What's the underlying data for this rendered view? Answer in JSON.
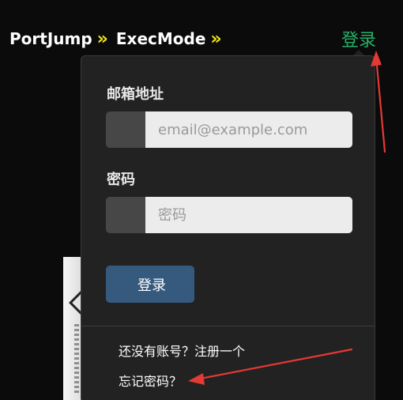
{
  "header": {
    "breadcrumb": [
      "PortJump",
      "ExecMode"
    ],
    "separator": "»",
    "login_label": "登录"
  },
  "login_form": {
    "email_label": "邮箱地址",
    "email_placeholder": "email@example.com",
    "email_value": "",
    "password_label": "密码",
    "password_placeholder": "密码",
    "password_value": "",
    "submit_label": "登录",
    "register_link": "还没有账号？注册一个",
    "forgot_link": "忘记密码？"
  },
  "colors": {
    "brand_text": "#ffffff",
    "breadcrumb_separator": "#f1e21b",
    "login_link": "#26b06a",
    "panel_bg": "#222222",
    "submit_button": "#365a7e",
    "annotation": "#e53935"
  },
  "icons": {
    "breadcrumb_separator": "chevron-double-right-icon"
  }
}
